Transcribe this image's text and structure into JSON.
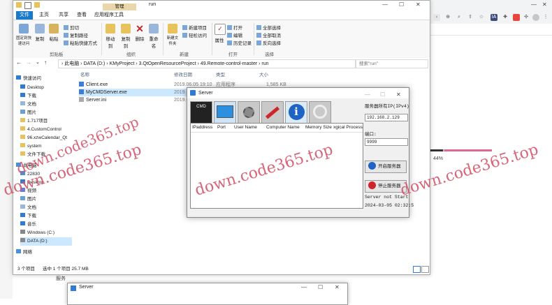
{
  "explorer": {
    "window_title": "run",
    "context_tab": "管理",
    "tabs": [
      "文件",
      "主页",
      "共享",
      "查看",
      "应用程序工具"
    ],
    "ribbon": {
      "pin_label": "固定到快速访问",
      "copy_label": "复制",
      "paste_label": "粘贴",
      "cut_label": "剪切",
      "copy_path_label": "复制路径",
      "paste_shortcut_label": "粘贴快捷方式",
      "move_to_label": "移动到",
      "copy_to_label": "复制到",
      "delete_label": "删除",
      "rename_label": "重命名",
      "new_folder_label": "新建文件夹",
      "new_item_label": "新建项目",
      "easy_access_label": "轻松访问",
      "properties_label": "属性",
      "open_label": "打开",
      "edit_label": "编辑",
      "history_label": "历史记录",
      "select_all_label": "全部选择",
      "select_none_label": "全部取消",
      "invert_label": "反向选择",
      "groups": {
        "clipboard": "剪贴板",
        "organize": "组织",
        "new": "新建",
        "open": "打开",
        "select": "选择"
      }
    },
    "address": {
      "path": "› 此电脑 › DATA (D:) › KMyProject › 3.QtOpenResourceProject › 49.Remote-control-master › run",
      "search_placeholder": "搜索\"run\""
    },
    "nav": {
      "quick_access": "快速访问",
      "items": [
        "Desktop",
        "下载",
        "文档",
        "图片",
        "1.717项目",
        "4.CustomControl",
        "96.xzwCalendar_Qt",
        "system",
        "文件下载",
        "此电脑",
        "22830",
        "Desktop",
        "视频",
        "图片",
        "文档",
        "下载",
        "音乐",
        "Windows (C:)",
        "DATA (D:)",
        "网络"
      ]
    },
    "columns": {
      "name": "名称",
      "date": "修改日期",
      "type": "类型",
      "size": "大小"
    },
    "files": [
      {
        "name": "Client.exe",
        "date": "2019.06.05 19:10",
        "type": "应用程序",
        "size": "1,585 KB"
      },
      {
        "name": "MyCMDServer.exe",
        "date": "2019.0"
      },
      {
        "name": "Server.ini",
        "date": "2019.0"
      }
    ],
    "status": {
      "count": "3 个项目",
      "selected": "选中 1 个项目  25.7 MB"
    }
  },
  "server": {
    "title": "Server",
    "toolbar_icons": [
      "cmd-icon",
      "monitor-icon",
      "settings-icon",
      "pen-icon",
      "info-icon",
      "power-icon"
    ],
    "cmd_label": "CMD",
    "columns": [
      "IPaddress",
      "Port",
      "User Name",
      "Computer Name",
      "Memory Size",
      "xgical Process"
    ],
    "ip_label": "服务器所有IP(IPv4)",
    "ip_value": "192.168.2.129",
    "port_label": "端口:",
    "port_value": "9999",
    "start_button": "开启服务器",
    "stop_button": "停止服务器",
    "status_text": "Server not Start",
    "timestamp": "2024-03-05 02:32:5"
  },
  "server2": {
    "title": "Server"
  },
  "browser": {
    "progress_text": "44%",
    "frag_left": "服务"
  },
  "watermarks": [
    "down.code365.top",
    "down.code365.top",
    "down.code365.top",
    "down.code365.top"
  ],
  "colors": {
    "accent": "#1979ca",
    "watermark": "#d4566b",
    "selection": "#cce8ff",
    "mgmt_tab": "#ead6a8"
  }
}
